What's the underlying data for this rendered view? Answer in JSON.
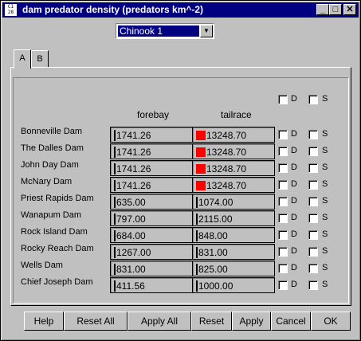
{
  "window": {
    "title": "dam predator density (predators km^-2)",
    "icon_text": "C1 28",
    "minimize_label": "_",
    "maximize_label": "□",
    "close_label": "✕"
  },
  "selector": {
    "value": "Chinook 1",
    "arrow": "▼"
  },
  "tabs": [
    {
      "label": "A"
    },
    {
      "label": "B"
    }
  ],
  "columns": {
    "forebay": "forebay",
    "tailrace": "tailrace"
  },
  "header_checkboxes": {
    "d_label": "D",
    "s_label": "S"
  },
  "rows": [
    {
      "name": "Bonneville Dam",
      "forebay": "1741.26",
      "tailrace": "13248.70"
    },
    {
      "name": "The Dalles Dam",
      "forebay": "1741.26",
      "tailrace": "13248.70"
    },
    {
      "name": "John Day Dam",
      "forebay": "1741.26",
      "tailrace": "13248.70"
    },
    {
      "name": "McNary Dam",
      "forebay": "1741.26",
      "tailrace": "13248.70"
    },
    {
      "name": "Priest Rapids Dam",
      "forebay": "635.00",
      "tailrace": "1074.00"
    },
    {
      "name": "Wanapum Dam",
      "forebay": "797.00",
      "tailrace": "2115.00"
    },
    {
      "name": "Rock Island Dam",
      "forebay": "684.00",
      "tailrace": "848.00"
    },
    {
      "name": "Rocky Reach Dam",
      "forebay": "1267.00",
      "tailrace": "831.00"
    },
    {
      "name": "Wells Dam",
      "forebay": "831.00",
      "tailrace": "825.00"
    },
    {
      "name": "Chief Joseph Dam",
      "forebay": "411.56",
      "tailrace": "1000.00"
    }
  ],
  "row_checkbox_labels": {
    "d": "D",
    "s": "S"
  },
  "buttons": {
    "help": "Help",
    "reset_all": "Reset All",
    "apply_all": "Apply All",
    "reset": "Reset",
    "apply": "Apply",
    "cancel": "Cancel",
    "ok": "OK"
  },
  "colors": {
    "title_bar": "#000080",
    "face": "#c0c0c0",
    "highlight_swatch": "#ff0000"
  }
}
